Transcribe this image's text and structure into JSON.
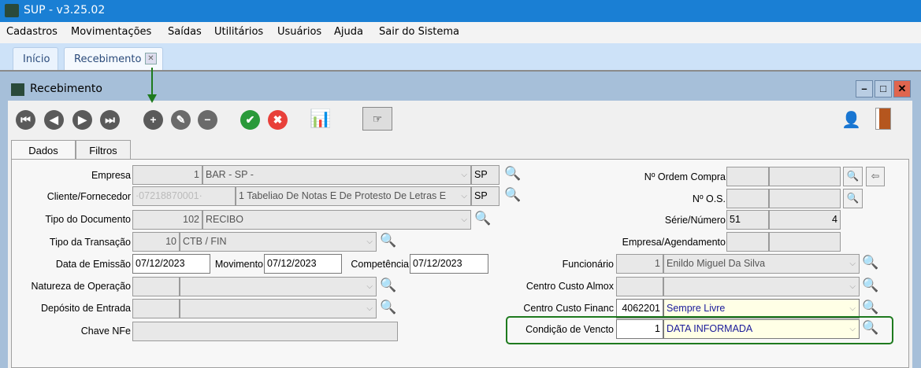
{
  "app": {
    "title": "SUP - v3.25.02"
  },
  "menu": [
    "Cadastros",
    "Movimentações",
    "Saídas",
    "Utilitários",
    "Usuários",
    "Ajuda",
    "Sair do Sistema"
  ],
  "page_tabs": [
    {
      "label": "Início"
    },
    {
      "label": "Recebimento"
    }
  ],
  "window": {
    "title": "Recebimento"
  },
  "toolbar": {
    "icons": [
      "first-icon",
      "previous-icon",
      "next-icon",
      "last-icon",
      "add-icon",
      "edit-icon",
      "remove-icon",
      "confirm-icon",
      "cancel-icon",
      "chart-settings-icon",
      "pointer-icon",
      "user-shield-icon",
      "exit-door-icon"
    ]
  },
  "form_tabs": [
    "Dados",
    "Filtros"
  ],
  "left": {
    "empresa": {
      "label": "Empresa",
      "code": "1",
      "desc": "BAR - SP -",
      "uf": "SP"
    },
    "cliente": {
      "label": "Cliente/Fornecedor",
      "code": "·07218870001·",
      "desc": "1 Tabeliao De Notas E De Protesto De Letras E",
      "uf": "SP"
    },
    "tipo_doc": {
      "label": "Tipo do Documento",
      "code": "102",
      "desc": "RECIBO"
    },
    "tipo_trans": {
      "label": "Tipo da Transação",
      "code": "10",
      "desc": "CTB / FIN"
    },
    "data_emissao": {
      "label": "Data de Emissão",
      "value": "07/12/2023"
    },
    "movimento": {
      "label": "Movimento",
      "value": "07/12/2023"
    },
    "competencia": {
      "label": "Competência",
      "value": "07/12/2023"
    },
    "natureza": {
      "label": "Natureza de Operação",
      "code": "",
      "desc": ""
    },
    "deposito": {
      "label": "Depósito de Entrada",
      "code": "",
      "desc": ""
    },
    "chave": {
      "label": "Chave NFe",
      "value": ""
    }
  },
  "right": {
    "ordem": {
      "label": "Nº Ordem Compra",
      "a": "",
      "b": ""
    },
    "os": {
      "label": "Nº O.S.",
      "a": "",
      "b": ""
    },
    "serie": {
      "label": "Série/Número",
      "a": "51",
      "b": "4"
    },
    "agend": {
      "label": "Empresa/Agendamento",
      "a": "",
      "b": ""
    },
    "funcionario": {
      "label": "Funcionário",
      "code": "1",
      "desc": "Enildo Miguel Da Silva"
    },
    "cc_almox": {
      "label": "Centro Custo Almox",
      "code": "",
      "desc": ""
    },
    "cc_financ": {
      "label": "Centro Custo Financ",
      "code": "4062201",
      "desc": "Sempre Livre"
    },
    "cond_vencto": {
      "label": "Condição de Vencto",
      "code": "1",
      "desc": "DATA INFORMADA"
    }
  },
  "highlight_color": "#1e7a1e"
}
